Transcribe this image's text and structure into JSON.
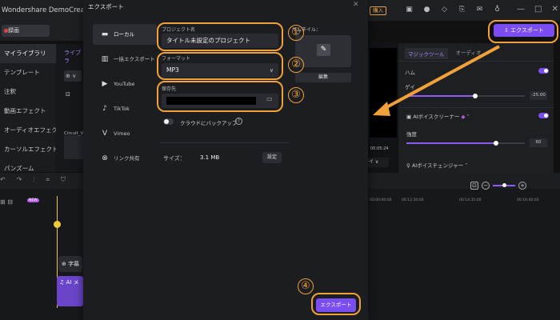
{
  "app": {
    "title": "Wondershare DemoCreator",
    "buy_label": "購入"
  },
  "header": {
    "record_label": "録画",
    "export_label": "エクスポート"
  },
  "left_nav": {
    "items": [
      {
        "label": "マイライブラリ",
        "active": true
      },
      {
        "label": "テンプレート",
        "active": false
      },
      {
        "label": "注釈",
        "active": false
      },
      {
        "label": "動画エフェクト",
        "active": false
      },
      {
        "label": "オーディオエフェクト",
        "active": false
      },
      {
        "label": "カーソルエフェクト",
        "active": false
      },
      {
        "label": "パンズーム",
        "active": false
      }
    ]
  },
  "media": {
    "tab": "ライブラ",
    "file_name": "Circuit_V"
  },
  "preview": {
    "time": "00:05:24"
  },
  "right_panel": {
    "tabs": [
      "マジックツール",
      "オーディオ"
    ],
    "row1_label": "ハム",
    "row2_label": "ゲイ",
    "gain_value": "-25.00",
    "ai_cleaner": "AIボイスクリーナー",
    "strength_label": "強度",
    "strength_value": "60",
    "ai_changer": "AIボイスチェンジャー"
  },
  "timeline": {
    "ruler": [
      "00:00:00:00",
      "00:12:30:00",
      "00:14:35:00",
      "00:16:40:00"
    ],
    "text_clip": "字幕",
    "audio_clip": "AI メ",
    "new_badge": "NEW"
  },
  "dialog": {
    "title": "エクスポート",
    "side_items": [
      {
        "label": "ローカル",
        "icon": "monitor-icon",
        "active": true
      },
      {
        "label": "一括エクスポート",
        "icon": "grid-icon",
        "active": false
      },
      {
        "label": "YouTube",
        "icon": "youtube-icon",
        "active": false
      },
      {
        "label": "TikTok",
        "icon": "tiktok-icon",
        "active": false
      },
      {
        "label": "Vimeo",
        "icon": "vimeo-icon",
        "active": false
      },
      {
        "label": "リンク共有",
        "icon": "link-share-icon",
        "active": false
      }
    ],
    "project_name_label": "プロジェクト名",
    "project_name_value": "タイトル未設定のプロジェクト",
    "format_label": "フォーマット",
    "format_value": "MP3",
    "save_to_label": "保存先",
    "backup_label": "クラウドにバックアップ",
    "size_label": "サイズ：",
    "size_value": "3.1 MB",
    "settings_label": "設定",
    "thumbnail_label": "サムネイル：",
    "edit_label": "編集",
    "export_label": "エクスポート"
  },
  "annotations": {
    "step1": "①",
    "step2": "②",
    "step3": "③",
    "step4": "④"
  },
  "colors": {
    "accent": "#7b4cf0",
    "annotation": "#f0a13a"
  }
}
